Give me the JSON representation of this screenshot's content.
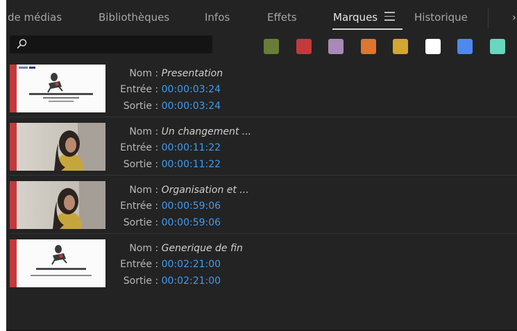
{
  "tabs": [
    {
      "label": "de médias",
      "active": false
    },
    {
      "label": "Bibliothèques",
      "active": false
    },
    {
      "label": "Infos",
      "active": false
    },
    {
      "label": "Effets",
      "active": false
    },
    {
      "label": "Marques",
      "active": true
    },
    {
      "label": "Historique",
      "active": false
    }
  ],
  "search": {
    "value": "",
    "placeholder": ""
  },
  "color_filters": [
    "#6b7c39",
    "#c23a3c",
    "#a88ab8",
    "#dc7630",
    "#d3a532",
    "#ffffff",
    "#4e89ec",
    "#69d6bf"
  ],
  "fields": {
    "name_label": "Nom",
    "in_label": "Entrée",
    "out_label": "Sortie",
    "separator": ":"
  },
  "markers": [
    {
      "name": "Presentation",
      "in": "00:00:03:24",
      "out": "00:00:03:24",
      "thumb": "title-card-icon",
      "color": "#c23a3c"
    },
    {
      "name": "Un changement ...",
      "in": "00:00:11:22",
      "out": "00:00:11:22",
      "thumb": "person-video-icon",
      "color": "#c23a3c"
    },
    {
      "name": "Organisation et ...",
      "in": "00:00:59:06",
      "out": "00:00:59:06",
      "thumb": "person-video-icon",
      "color": "#c23a3c"
    },
    {
      "name": "Generique de fin",
      "in": "00:02:21:00",
      "out": "00:02:21:00",
      "thumb": "credits-card-icon",
      "color": "#c23a3c"
    }
  ]
}
